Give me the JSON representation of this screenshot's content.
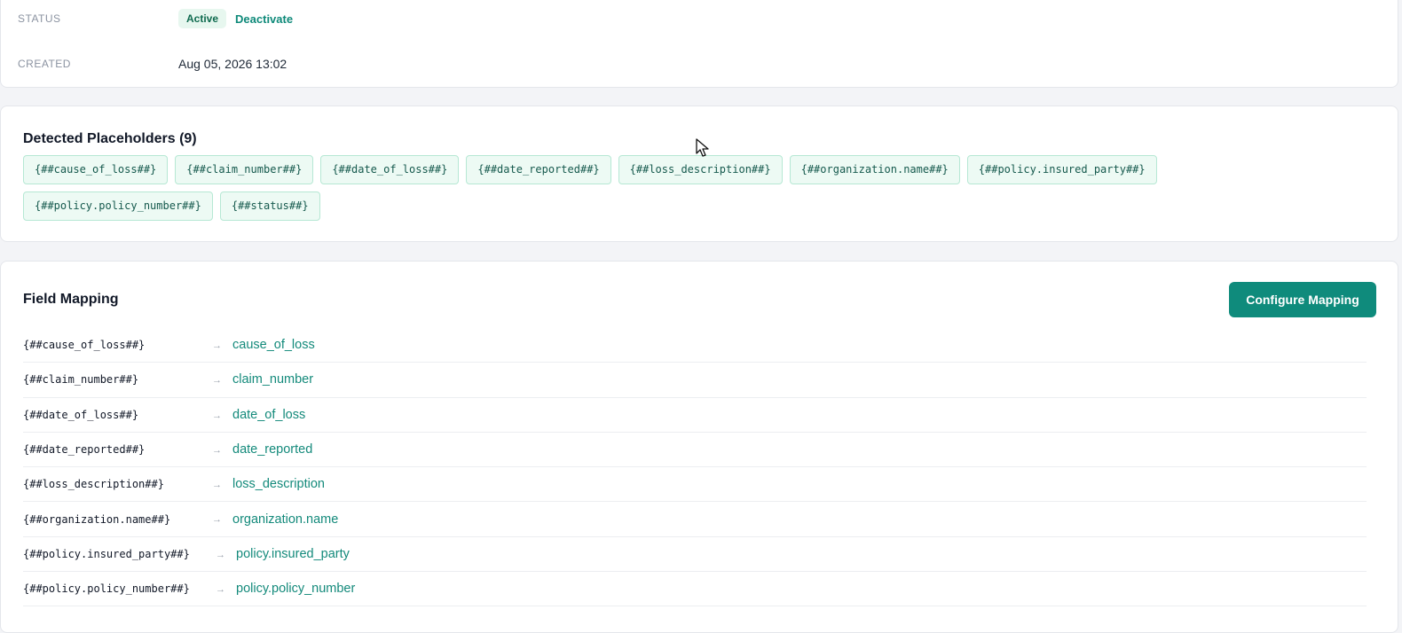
{
  "details": {
    "status_label": "STATUS",
    "status_badge": "Active",
    "deactivate_label": "Deactivate",
    "created_label": "CREATED",
    "created_value": "Aug 05, 2026 13:02"
  },
  "placeholders": {
    "title": "Detected Placeholders (9)",
    "items": [
      "{##cause_of_loss##}",
      "{##claim_number##}",
      "{##date_of_loss##}",
      "{##date_reported##}",
      "{##loss_description##}",
      "{##organization.name##}",
      "{##policy.insured_party##}",
      "{##policy.policy_number##}",
      "{##status##}"
    ]
  },
  "mapping": {
    "title": "Field Mapping",
    "configure_label": "Configure Mapping",
    "arrow": "→",
    "rows": [
      {
        "key": "{##cause_of_loss##}",
        "value": "cause_of_loss"
      },
      {
        "key": "{##claim_number##}",
        "value": "claim_number"
      },
      {
        "key": "{##date_of_loss##}",
        "value": "date_of_loss"
      },
      {
        "key": "{##date_reported##}",
        "value": "date_reported"
      },
      {
        "key": "{##loss_description##}",
        "value": "loss_description"
      },
      {
        "key": "{##organization.name##}",
        "value": "organization.name"
      },
      {
        "key": "{##policy.insured_party##}",
        "value": "policy.insured_party"
      },
      {
        "key": "{##policy.policy_number##}",
        "value": "policy.policy_number"
      }
    ]
  },
  "colors": {
    "accent": "#0f8b7c",
    "chip_bg": "#edfaf4",
    "badge_bg": "#e7f7ef"
  }
}
